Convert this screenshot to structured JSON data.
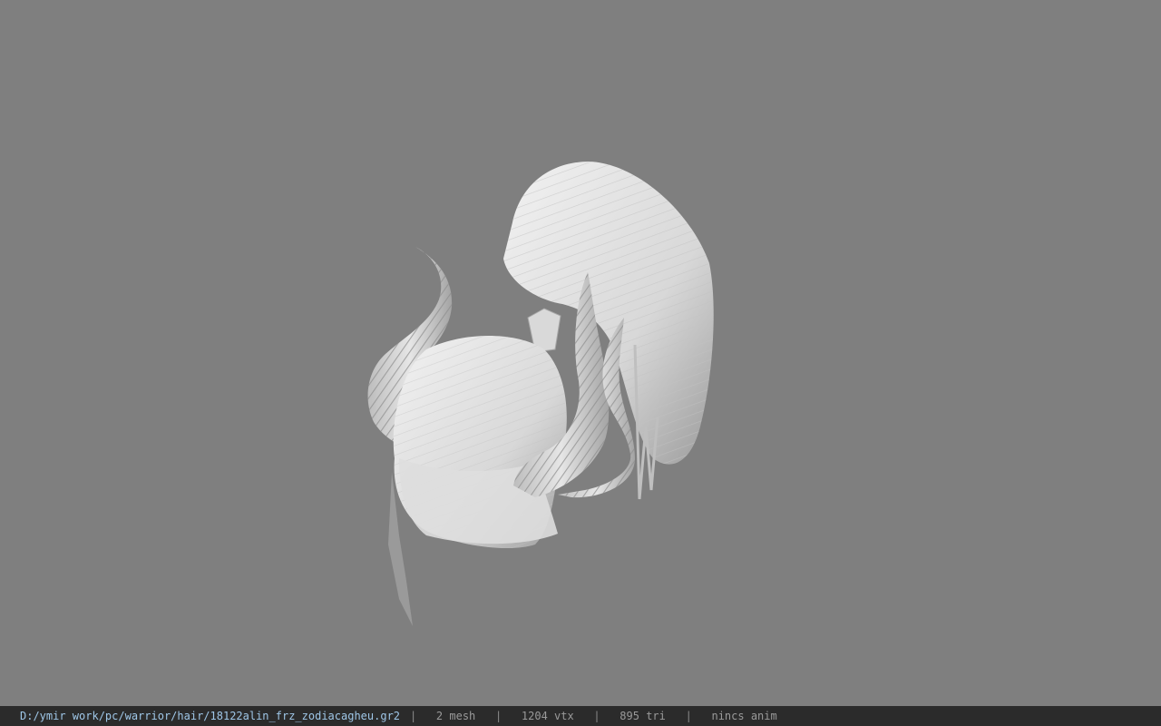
{
  "viewport": {
    "background": "#7f7f7f",
    "model_name": "hair mesh with horns"
  },
  "status": {
    "path": "D:/ymir work/pc/warrior/hair/18122alin_frz_zodiacagheu.gr2",
    "sep": "|",
    "meshes": "2 mesh",
    "vertices": "1204 vtx",
    "triangles": "895 tri",
    "anim": "nincs anim"
  }
}
